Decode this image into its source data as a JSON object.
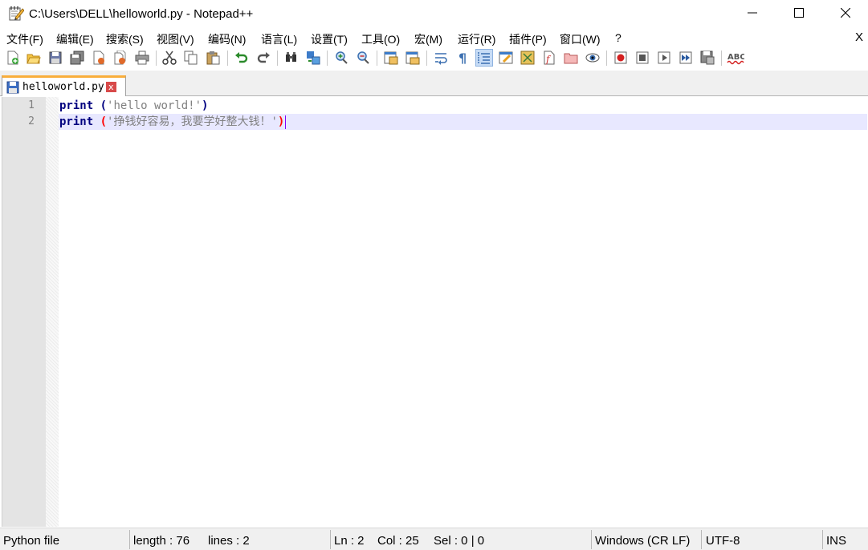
{
  "window": {
    "title": "C:\\Users\\DELL\\helloworld.py - Notepad++",
    "icon": "notepad-app-icon"
  },
  "menu": [
    "文件(F)",
    "编辑(E)",
    "搜索(S)",
    "视图(V)",
    "编码(N)",
    "语言(L)",
    "设置(T)",
    "工具(O)",
    "宏(M)",
    "运行(R)",
    "插件(P)",
    "窗口(W)",
    "?"
  ],
  "menu_close": "X",
  "toolbar": {
    "icons": [
      "new-file-icon",
      "open-file-icon",
      "save-icon",
      "save-all-icon",
      "close-icon",
      "close-all-icon",
      "print-icon",
      "cut-icon",
      "copy-icon",
      "paste-icon",
      "undo-icon",
      "redo-icon",
      "find-icon",
      "replace-icon",
      "zoom-in-icon",
      "zoom-out-icon",
      "sync-vertical-icon",
      "sync-horizontal-icon",
      "word-wrap-icon",
      "show-all-chars-icon",
      "indent-guide-icon",
      "udl-icon",
      "doc-map-icon",
      "function-list-icon",
      "folder-workspace-icon",
      "monitoring-icon",
      "record-macro-icon",
      "stop-record-icon",
      "playback-macro-icon",
      "run-macro-multiple-icon",
      "save-macro-icon",
      "spell-check-icon"
    ],
    "spell_check_label": "ABC"
  },
  "tab": {
    "filename": "helloworld.py",
    "close_glyph": "x"
  },
  "editor": {
    "lines": [
      {
        "number": "1",
        "keyword": "print",
        "space": " ",
        "open": "(",
        "string": "'hello world!'",
        "close": ")"
      },
      {
        "number": "2",
        "keyword": "print",
        "space": " ",
        "open": "(",
        "string": "'挣钱好容易，我要学好整大钱！'",
        "close": ")"
      }
    ]
  },
  "status": {
    "language": "Python file",
    "length": "length : 76",
    "lines": "lines : 2",
    "ln": "Ln : 2",
    "col": "Col : 25",
    "sel": "Sel : 0 | 0",
    "eol": "Windows (CR LF)",
    "encoding": "UTF-8",
    "mode": "INS"
  },
  "colors": {
    "keyword": "#00007f",
    "string": "#808080",
    "brace_highlight": "#ff0000",
    "current_line": "#e8e8ff",
    "tab_accent": "#f9ae3c"
  }
}
